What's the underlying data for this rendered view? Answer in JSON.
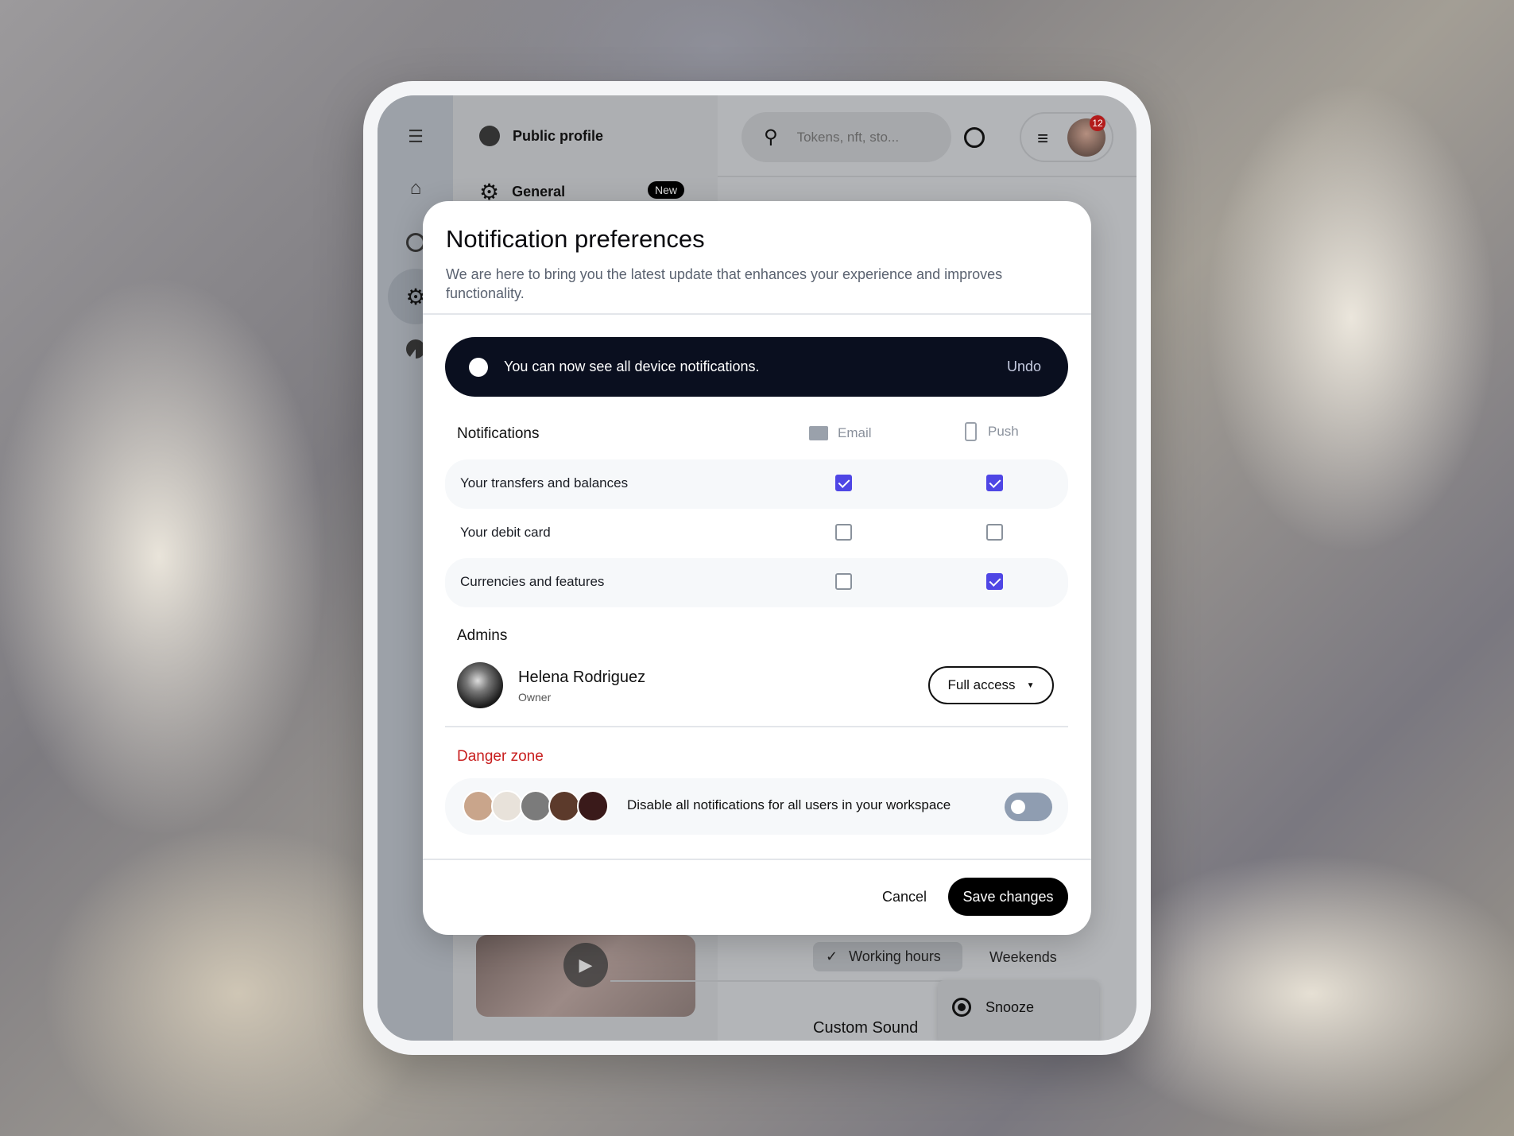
{
  "app": {
    "sidebar_icons": [
      "menu-collapse-icon",
      "home-icon",
      "chart-icon",
      "gear-icon",
      "pie-chart-icon"
    ],
    "nav": [
      {
        "label": "Public profile",
        "icon": "user-circle-icon"
      },
      {
        "label": "General",
        "icon": "gear-icon",
        "badge": "New"
      }
    ],
    "search": {
      "placeholder": "Tokens, nft, sto..."
    },
    "notification_count": "12",
    "chips": {
      "working_hours": "Working hours",
      "weekends": "Weekends"
    },
    "menu": {
      "snooze": "Snooze"
    },
    "custom_sound": "Custom Sound"
  },
  "modal": {
    "title": "Notification preferences",
    "description": "We are here to bring you the latest update that enhances your experience and improves functionality.",
    "toast": {
      "message": "You can now see all device notifications.",
      "action": "Undo"
    },
    "notifications": {
      "heading": "Notifications",
      "email_label": "Email",
      "push_label": "Push",
      "rows": [
        {
          "label": "Your transfers and balances",
          "email": true,
          "push": true
        },
        {
          "label": "Your debit card",
          "email": false,
          "push": false
        },
        {
          "label": "Currencies and features",
          "email": false,
          "push": true
        }
      ]
    },
    "admins": {
      "heading": "Admins",
      "name": "Helena Rodriguez",
      "role": "Owner",
      "access": "Full access"
    },
    "danger": {
      "heading": "Danger zone",
      "text": "Disable all notifications for all users in your workspace",
      "toggle_on": false
    },
    "cancel": "Cancel",
    "save": "Save changes",
    "colors": {
      "accent": "#4f46e5",
      "danger": "#c81e1e",
      "toast_bg": "#0a0f1f"
    }
  }
}
